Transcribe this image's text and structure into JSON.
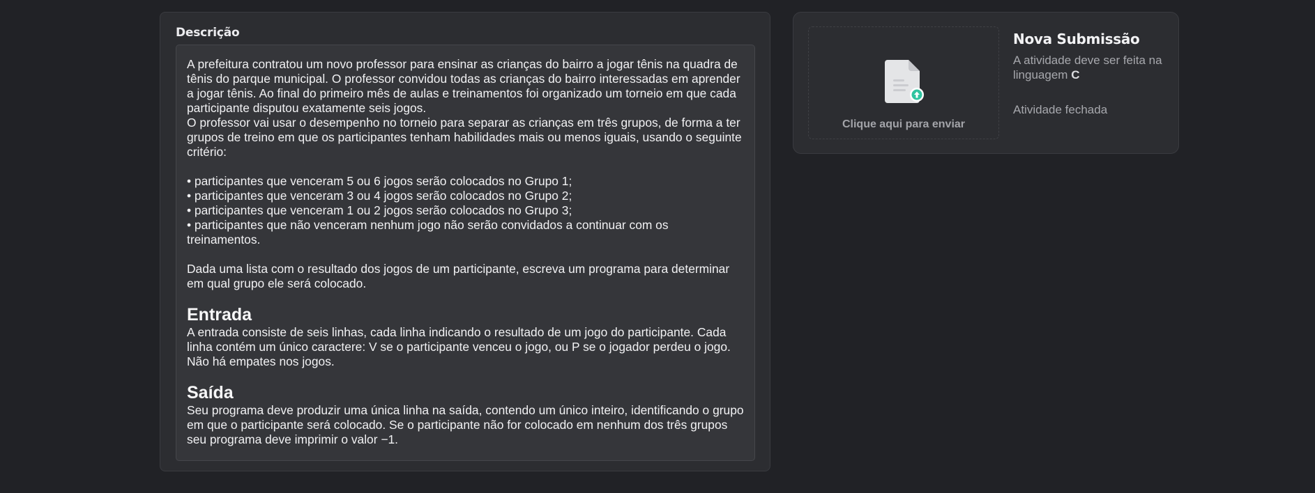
{
  "description": {
    "title": "Descrição",
    "paragraphs": [
      "A prefeitura contratou um novo professor para ensinar as crianças do bairro a jogar tênis na quadra de tênis do parque municipal. O professor convidou todas as crianças do bairro interessadas em aprender a jogar tênis. Ao final do primeiro mês de aulas e treinamentos foi organizado um torneio em que cada participante disputou exatamente seis jogos.",
      "O professor vai usar o desempenho no torneio para separar as crianças em três grupos, de forma a ter grupos de treino em que os participantes tenham habilidades mais ou menos iguais, usando o seguinte critério:"
    ],
    "criteria": [
      "• participantes que venceram 5 ou 6 jogos serão colocados no Grupo 1;",
      "• participantes que venceram 3 ou 4 jogos serão colocados no Grupo 2;",
      "• participantes que venceram 1 ou 2 jogos serão colocados no Grupo 3;",
      "• participantes que não venceram nenhum jogo não serão convidados a continuar com os treinamentos."
    ],
    "task": "Dada uma lista com o resultado dos jogos de um participante, escreva um programa para determinar em qual grupo ele será colocado.",
    "input_heading": "Entrada",
    "input_text": "A entrada consiste de seis linhas, cada linha indicando o resultado de um jogo do participante. Cada linha contém um único caractere: V se o participante venceu o jogo, ou P se o jogador perdeu o jogo. Não há empates nos jogos.",
    "output_heading": "Saída",
    "output_text": "Seu programa deve produzir uma única linha na saída, contendo um único inteiro, identificando o grupo em que o participante será colocado. Se o participante não for colocado em nenhum dos três grupos seu programa deve imprimir o valor −1."
  },
  "submission": {
    "upload_label": "Clique aqui para enviar",
    "upload_icon": "file-upload-icon",
    "title": "Nova Submissão",
    "language_text": "A atividade deve ser feita na linguagem",
    "language": "C",
    "status": "Atividade fechada",
    "accent_color": "#2fc4a0"
  }
}
